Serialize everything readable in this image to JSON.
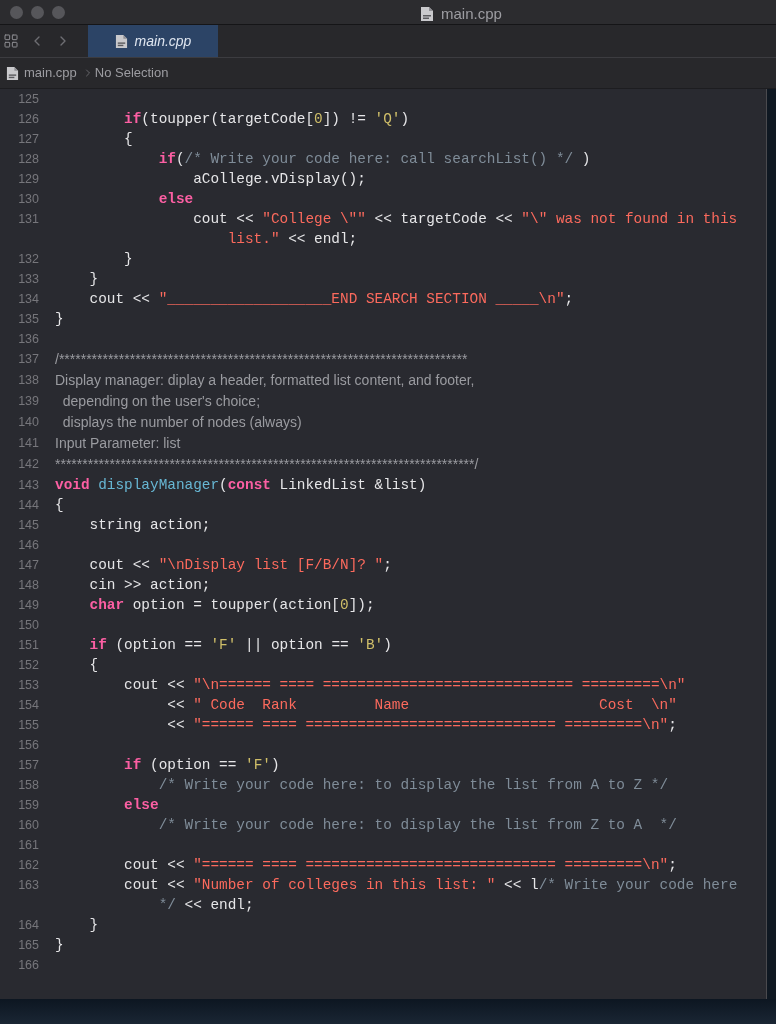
{
  "window": {
    "title": "main.cpp"
  },
  "tabs": [
    {
      "label": "main.cpp",
      "selected": true
    }
  ],
  "jump_bar": {
    "file": "main.cpp",
    "selection": "No Selection"
  },
  "editor": {
    "lines": [
      {
        "number": "125"
      },
      {
        "number": "126",
        "tokens": [
          {
            "kind": "keyword",
            "text": "        if"
          },
          {
            "kind": "plain",
            "text": "(toupper(targetCode["
          },
          {
            "kind": "number",
            "text": "0"
          },
          {
            "kind": "plain",
            "text": "]) != "
          },
          {
            "kind": "number",
            "text": "'Q'"
          },
          {
            "kind": "plain",
            "text": ")"
          }
        ]
      },
      {
        "number": "127",
        "tokens": [
          {
            "kind": "plain",
            "text": "        {"
          }
        ]
      },
      {
        "number": "128",
        "tokens": [
          {
            "kind": "keyword",
            "text": "            if"
          },
          {
            "kind": "plain",
            "text": "("
          },
          {
            "kind": "comment",
            "text": "/* Write your code here: call searchList() */"
          },
          {
            "kind": "plain",
            "text": " )"
          }
        ]
      },
      {
        "number": "129",
        "tokens": [
          {
            "kind": "plain",
            "text": "                aCollege.vDisplay();"
          }
        ]
      },
      {
        "number": "130",
        "tokens": [
          {
            "kind": "keyword",
            "text": "            else"
          }
        ]
      },
      {
        "number": "131",
        "tokens": [
          {
            "kind": "plain",
            "text": "                cout << "
          },
          {
            "kind": "string",
            "text": "\"College \\\"\""
          },
          {
            "kind": "plain",
            "text": " << targetCode << "
          },
          {
            "kind": "string",
            "text": "\"\\\" was not found in this"
          }
        ],
        "wrap": [
          {
            "kind": "string",
            "text": "                    list.\""
          },
          {
            "kind": "plain",
            "text": " << endl;"
          }
        ]
      },
      {
        "number": "132",
        "tokens": [
          {
            "kind": "plain",
            "text": "        }"
          }
        ]
      },
      {
        "number": "133",
        "tokens": [
          {
            "kind": "plain",
            "text": "    }"
          }
        ]
      },
      {
        "number": "134",
        "tokens": [
          {
            "kind": "plain",
            "text": "    cout << "
          },
          {
            "kind": "string",
            "text": "\"___________________END SEARCH SECTION _____\\n\""
          },
          {
            "kind": "plain",
            "text": ";"
          }
        ]
      },
      {
        "number": "135",
        "tokens": [
          {
            "kind": "plain",
            "text": "}"
          }
        ]
      },
      {
        "number": "136"
      },
      {
        "number": "137",
        "tokens": [
          {
            "kind": "doc",
            "text": "/***************************************************************************"
          }
        ]
      },
      {
        "number": "138",
        "tokens": [
          {
            "kind": "doc",
            "text": "Display manager: diplay a header, formatted list content, and footer,"
          }
        ]
      },
      {
        "number": "139",
        "tokens": [
          {
            "kind": "doc",
            "text": "  depending on the user's choice;"
          }
        ]
      },
      {
        "number": "140",
        "tokens": [
          {
            "kind": "doc",
            "text": "  displays the number of nodes (always)"
          }
        ]
      },
      {
        "number": "141",
        "tokens": [
          {
            "kind": "doc",
            "text": "Input Parameter: list"
          }
        ]
      },
      {
        "number": "142",
        "tokens": [
          {
            "kind": "doc",
            "text": "*****************************************************************************/"
          }
        ]
      },
      {
        "number": "143",
        "tokens": [
          {
            "kind": "keyword",
            "text": "void"
          },
          {
            "kind": "function",
            "text": " displayManager"
          },
          {
            "kind": "plain",
            "text": "("
          },
          {
            "kind": "keyword",
            "text": "const"
          },
          {
            "kind": "plain",
            "text": " LinkedList &list)"
          }
        ]
      },
      {
        "number": "144",
        "tokens": [
          {
            "kind": "plain",
            "text": "{"
          }
        ]
      },
      {
        "number": "145",
        "tokens": [
          {
            "kind": "plain",
            "text": "    string action;"
          }
        ]
      },
      {
        "number": "146"
      },
      {
        "number": "147",
        "tokens": [
          {
            "kind": "plain",
            "text": "    cout << "
          },
          {
            "kind": "string",
            "text": "\"\\nDisplay list [F/B/N]? \""
          },
          {
            "kind": "plain",
            "text": ";"
          }
        ]
      },
      {
        "number": "148",
        "tokens": [
          {
            "kind": "plain",
            "text": "    cin >> action;"
          }
        ]
      },
      {
        "number": "149",
        "tokens": [
          {
            "kind": "keyword",
            "text": "    char"
          },
          {
            "kind": "plain",
            "text": " option = toupper(action["
          },
          {
            "kind": "number",
            "text": "0"
          },
          {
            "kind": "plain",
            "text": "]);"
          }
        ]
      },
      {
        "number": "150"
      },
      {
        "number": "151",
        "tokens": [
          {
            "kind": "keyword",
            "text": "    if"
          },
          {
            "kind": "plain",
            "text": " (option == "
          },
          {
            "kind": "number",
            "text": "'F'"
          },
          {
            "kind": "plain",
            "text": " || option == "
          },
          {
            "kind": "number",
            "text": "'B'"
          },
          {
            "kind": "plain",
            "text": ")"
          }
        ]
      },
      {
        "number": "152",
        "tokens": [
          {
            "kind": "plain",
            "text": "    {"
          }
        ]
      },
      {
        "number": "153",
        "tokens": [
          {
            "kind": "plain",
            "text": "        cout << "
          },
          {
            "kind": "string",
            "text": "\"\\n====== ==== ============================= =========\\n\""
          }
        ]
      },
      {
        "number": "154",
        "tokens": [
          {
            "kind": "plain",
            "text": "             << "
          },
          {
            "kind": "string",
            "text": "\" Code  Rank         Name                      Cost  \\n\""
          }
        ]
      },
      {
        "number": "155",
        "tokens": [
          {
            "kind": "plain",
            "text": "             << "
          },
          {
            "kind": "string",
            "text": "\"====== ==== ============================= =========\\n\""
          },
          {
            "kind": "plain",
            "text": ";"
          }
        ]
      },
      {
        "number": "156"
      },
      {
        "number": "157",
        "tokens": [
          {
            "kind": "keyword",
            "text": "        if"
          },
          {
            "kind": "plain",
            "text": " (option == "
          },
          {
            "kind": "number",
            "text": "'F'"
          },
          {
            "kind": "plain",
            "text": ")"
          }
        ]
      },
      {
        "number": "158",
        "tokens": [
          {
            "kind": "comment",
            "text": "            /* Write your code here: to display the list from A to Z */"
          }
        ]
      },
      {
        "number": "159",
        "tokens": [
          {
            "kind": "keyword",
            "text": "        else"
          }
        ]
      },
      {
        "number": "160",
        "tokens": [
          {
            "kind": "comment",
            "text": "            /* Write your code here: to display the list from Z to A  */"
          }
        ]
      },
      {
        "number": "161"
      },
      {
        "number": "162",
        "tokens": [
          {
            "kind": "plain",
            "text": "        cout << "
          },
          {
            "kind": "string",
            "text": "\"====== ==== ============================= =========\\n\""
          },
          {
            "kind": "plain",
            "text": ";"
          }
        ]
      },
      {
        "number": "163",
        "tokens": [
          {
            "kind": "plain",
            "text": "        cout << "
          },
          {
            "kind": "string",
            "text": "\"Number of colleges in this list: \""
          },
          {
            "kind": "plain",
            "text": " << l"
          },
          {
            "kind": "comment",
            "text": "/* Write your code here"
          }
        ],
        "wrap": [
          {
            "kind": "comment",
            "text": "            */"
          },
          {
            "kind": "plain",
            "text": " << endl;"
          }
        ]
      },
      {
        "number": "164",
        "tokens": [
          {
            "kind": "plain",
            "text": "    }"
          }
        ]
      },
      {
        "number": "165",
        "tokens": [
          {
            "kind": "plain",
            "text": "}"
          }
        ]
      },
      {
        "number": "166"
      }
    ]
  }
}
